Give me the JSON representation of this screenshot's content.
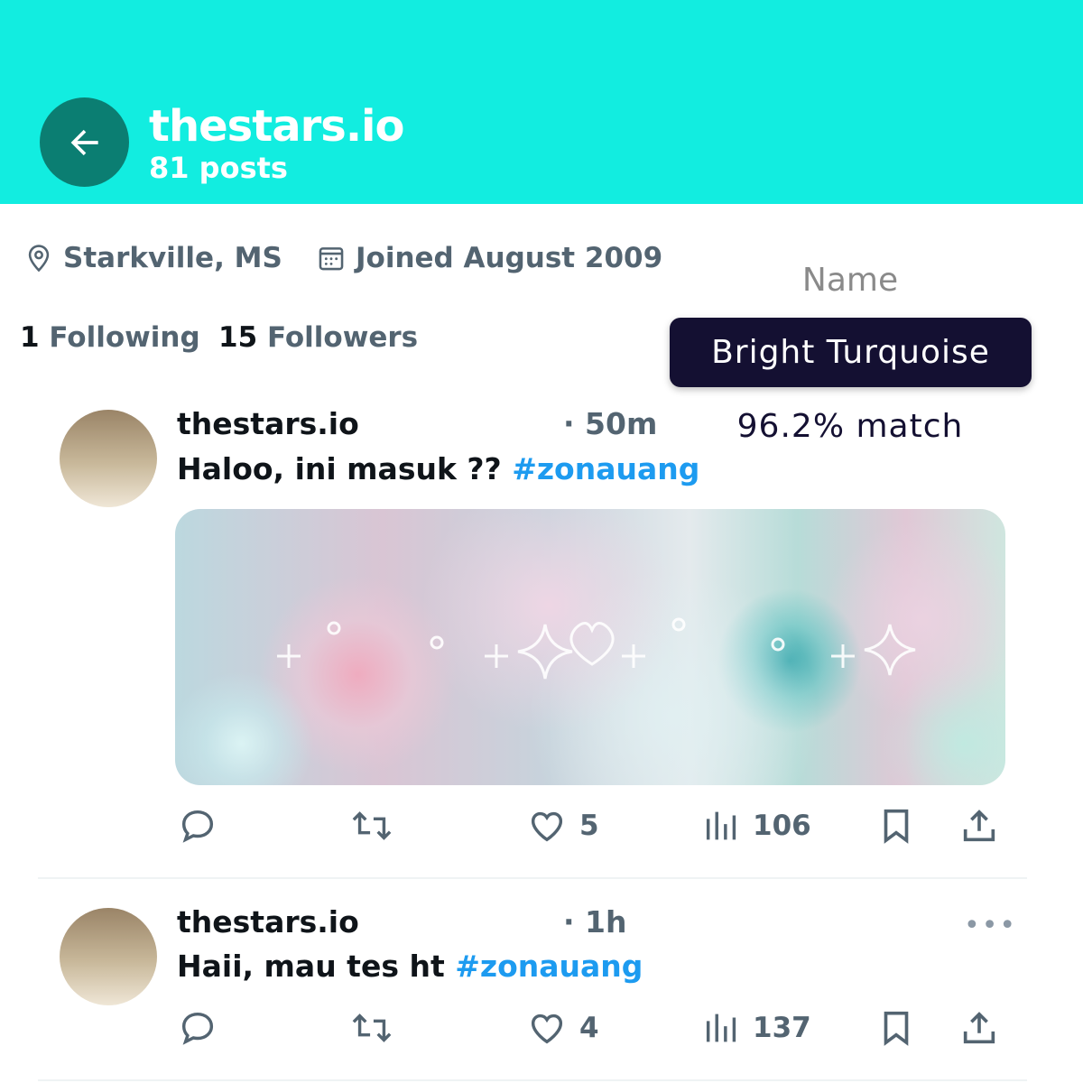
{
  "header": {
    "title": "thestars.io",
    "posts_count": "81 posts",
    "back_icon": "arrow-left-icon",
    "bg_color": "#12ede0",
    "back_color": "#0b7e72"
  },
  "profile": {
    "location": "Starkville, MS",
    "joined": "Joined August 2009",
    "following_count": "1",
    "following_label": "Following",
    "followers_count": "15",
    "followers_label": "Followers"
  },
  "color_overlay": {
    "label": "Name",
    "color_name": "Bright Turquoise",
    "match": "96.2% match",
    "pill_color": "#141032"
  },
  "posts": [
    {
      "user": "thestars.io",
      "time": "· 50m",
      "text": "Haloo, ini masuk ??",
      "hashtag": "#zonauang",
      "has_media": true,
      "likes": "5",
      "views": "106"
    },
    {
      "user": "thestars.io",
      "time": "· 1h",
      "text": "Haii, mau tes ht",
      "hashtag": "#zonauang",
      "has_media": false,
      "likes": "4",
      "views": "137"
    }
  ],
  "accent_color": "#1d9bf0"
}
